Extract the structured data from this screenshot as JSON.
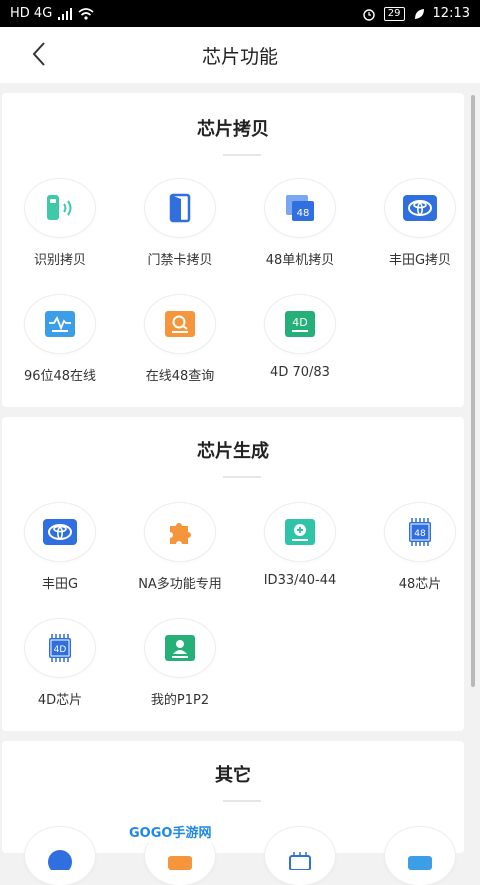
{
  "status_bar": {
    "network": "HD 4G",
    "battery": "29",
    "time": "12:13"
  },
  "header": {
    "title": "芯片功能"
  },
  "sections": [
    {
      "title": "芯片拷贝",
      "items": [
        {
          "label": "识别拷贝",
          "icon": "card-scan-icon"
        },
        {
          "label": "门禁卡拷贝",
          "icon": "door-icon"
        },
        {
          "label": "48单机拷贝",
          "icon": "chip-48-icon"
        },
        {
          "label": "丰田G拷贝",
          "icon": "toyota-icon"
        },
        {
          "label": "96位48在线",
          "icon": "waveform-icon"
        },
        {
          "label": "在线48查询",
          "icon": "search-box-icon"
        },
        {
          "label": "4D 70/83",
          "icon": "chip-4d-icon"
        }
      ]
    },
    {
      "title": "芯片生成",
      "items": [
        {
          "label": "丰田G",
          "icon": "toyota-icon"
        },
        {
          "label": "NA多功能专用",
          "icon": "puzzle-icon"
        },
        {
          "label": "ID33/40-44",
          "icon": "plus-chip-icon"
        },
        {
          "label": "48芯片",
          "icon": "chip-48-icon"
        },
        {
          "label": "4D芯片",
          "icon": "chip-4d-icon"
        },
        {
          "label": "我的P1P2",
          "icon": "user-card-icon"
        }
      ]
    },
    {
      "title": "其它",
      "items": []
    }
  ],
  "watermark": "GOGO手游网",
  "colors": {
    "blue": "#2f6fe0",
    "green": "#25b07a",
    "orange": "#f5963c",
    "teal": "#2fc4a8",
    "lightblue": "#3d9ee8"
  }
}
